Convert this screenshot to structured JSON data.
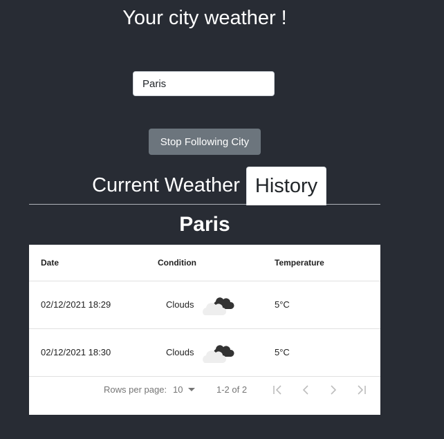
{
  "header": {
    "title": "Your city weather !"
  },
  "search": {
    "value": "Paris",
    "placeholder": ""
  },
  "follow_button": {
    "label": "Stop Following City"
  },
  "tabs": [
    {
      "label": "Current Weather",
      "active": false
    },
    {
      "label": "History",
      "active": true
    }
  ],
  "city": {
    "name": "Paris"
  },
  "table": {
    "columns": [
      "Date",
      "Condition",
      "Temperature"
    ],
    "rows": [
      {
        "date": "02/12/2021 18:29",
        "condition": "Clouds",
        "icon": "broken-clouds-icon",
        "temperature": "5°C"
      },
      {
        "date": "02/12/2021 18:30",
        "condition": "Clouds",
        "icon": "broken-clouds-icon",
        "temperature": "5°C"
      }
    ]
  },
  "pagination": {
    "rows_per_page_label": "Rows per page:",
    "rows_per_page_value": "10",
    "range_text": "1-2 of 2",
    "buttons": [
      "first-page-icon",
      "previous-page-icon",
      "next-page-icon",
      "last-page-icon"
    ]
  },
  "colors": {
    "background": "#282c34",
    "button": "#6c757d",
    "text_light": "#ffffff",
    "pagination_disabled": "#bdbdbd"
  }
}
